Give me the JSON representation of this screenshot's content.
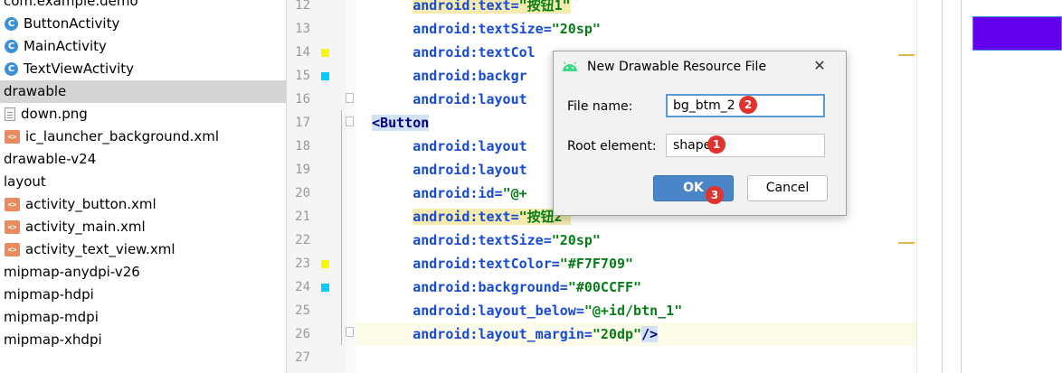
{
  "project_tree": {
    "items": [
      {
        "label": "com.example.demo",
        "icon": "none"
      },
      {
        "label": "ButtonActivity",
        "icon": "class-icon"
      },
      {
        "label": "MainActivity",
        "icon": "class-icon"
      },
      {
        "label": "TextViewActivity",
        "icon": "class-icon"
      },
      {
        "label": "drawable",
        "icon": "none",
        "selected": true
      },
      {
        "label": "down.png",
        "icon": "image-file-icon"
      },
      {
        "label": "ic_launcher_background.xml",
        "icon": "xml-file-icon"
      },
      {
        "label": "drawable-v24",
        "icon": "none"
      },
      {
        "label": "layout",
        "icon": "none"
      },
      {
        "label": "activity_button.xml",
        "icon": "xml-file-icon"
      },
      {
        "label": "activity_main.xml",
        "icon": "xml-file-icon"
      },
      {
        "label": "activity_text_view.xml",
        "icon": "xml-file-icon"
      },
      {
        "label": "mipmap-anydpi-v26",
        "icon": "none"
      },
      {
        "label": "mipmap-hdpi",
        "icon": "none"
      },
      {
        "label": "mipmap-mdpi",
        "icon": "none"
      },
      {
        "label": "mipmap-xhdpi",
        "icon": "none"
      }
    ]
  },
  "editor": {
    "lines": [
      {
        "num": "12",
        "indent": "    ",
        "attr": "android:text",
        "eq": "=",
        "val": "\"按钮1\"",
        "highlight_attr": true
      },
      {
        "num": "13",
        "indent": "    ",
        "attr": "android:textSize",
        "eq": "=",
        "val": "\"20sp\""
      },
      {
        "num": "14",
        "indent": "    ",
        "attr": "android:textCol",
        "eq": "",
        "val": "",
        "swatch": "#F7F709"
      },
      {
        "num": "15",
        "indent": "    ",
        "attr": "android:backgr",
        "eq": "",
        "val": "",
        "swatch": "#00CCFF"
      },
      {
        "num": "16",
        "indent": "    ",
        "attr": "android:layout",
        "eq": "",
        "val": ""
      },
      {
        "num": "17",
        "indent": "",
        "attr": "",
        "eq": "",
        "val": "",
        "tag": "<Button"
      },
      {
        "num": "18",
        "indent": "    ",
        "attr": "android:layout",
        "eq": "",
        "val": ""
      },
      {
        "num": "19",
        "indent": "    ",
        "attr": "android:layout",
        "eq": "",
        "val": ""
      },
      {
        "num": "20",
        "indent": "    ",
        "attr": "android:id",
        "eq": "=",
        "val": "\"@+"
      },
      {
        "num": "21",
        "indent": "    ",
        "attr": "android:text",
        "eq": "=",
        "val": "\"按钮2\"",
        "highlight_attr": true
      },
      {
        "num": "22",
        "indent": "    ",
        "attr": "android:textSize",
        "eq": "=",
        "val": "\"20sp\""
      },
      {
        "num": "23",
        "indent": "    ",
        "attr": "android:textColor",
        "eq": "=",
        "val": "\"#F7F709\"",
        "swatch": "#F7F709"
      },
      {
        "num": "24",
        "indent": "    ",
        "attr": "android:background",
        "eq": "=",
        "val": "\"#00CCFF\"",
        "swatch": "#00CCFF"
      },
      {
        "num": "25",
        "indent": "    ",
        "attr": "android:layout_below",
        "eq": "=",
        "val": "\"@+id/btn_1\""
      },
      {
        "num": "26",
        "indent": "    ",
        "attr": "android:layout_margin",
        "eq": "=",
        "val": "\"20dp\"",
        "tail": "/>",
        "current": true
      },
      {
        "num": "27",
        "indent": "",
        "attr": "",
        "eq": "",
        "val": ""
      }
    ]
  },
  "dialog": {
    "title": "New Drawable Resource File",
    "file_name_label": "File name:",
    "file_name_value": "bg_btm_2",
    "root_element_label": "Root element:",
    "root_element_value": "shape",
    "ok_label": "OK",
    "cancel_label": "Cancel",
    "close_glyph": "✕",
    "badges": [
      "1",
      "2",
      "3"
    ]
  },
  "colors": {
    "preview_button": "#6200EE",
    "attr": "#174AD4",
    "value": "#067D17",
    "dialog_ok": "#4A86C7",
    "badge": "#E2322E"
  }
}
